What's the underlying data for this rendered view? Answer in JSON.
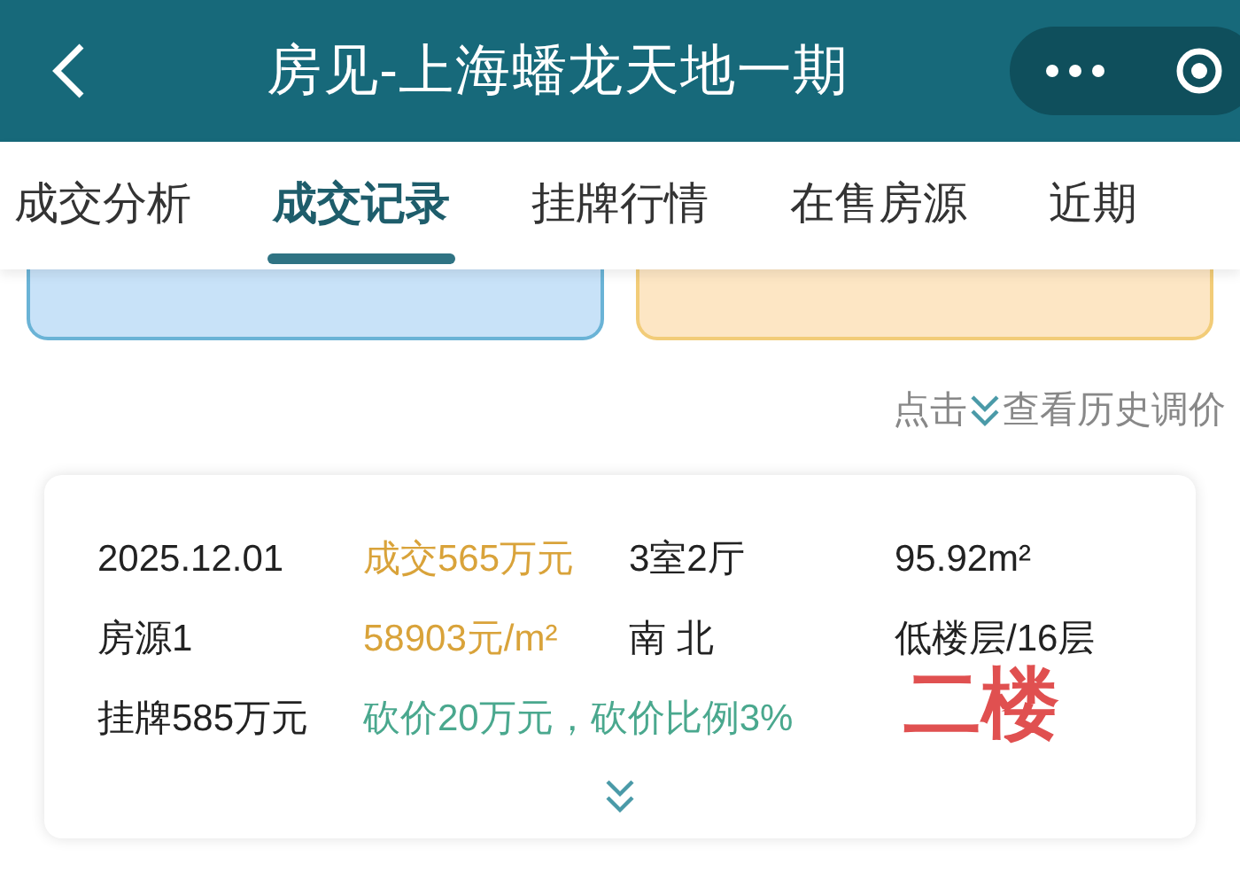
{
  "header": {
    "title": "房见-上海蟠龙天地一期"
  },
  "tabs": [
    {
      "label": "成交分析",
      "selected": false
    },
    {
      "label": "成交记录",
      "selected": true
    },
    {
      "label": "挂牌行情",
      "selected": false
    },
    {
      "label": "在售房源",
      "selected": false
    },
    {
      "label": "近期",
      "selected": false
    }
  ],
  "history_link": {
    "before": "点击",
    "after": "查看历史调价"
  },
  "record": {
    "rows": [
      [
        {
          "text": "2025.12.01",
          "kind": "plain"
        },
        {
          "text": "成交565万元",
          "kind": "price"
        },
        {
          "text": "3室2厅",
          "kind": "plain"
        },
        {
          "text": "95.92m²",
          "kind": "plain"
        }
      ],
      [
        {
          "text": "房源1",
          "kind": "plain"
        },
        {
          "text": "58903元/m²",
          "kind": "price"
        },
        {
          "text": "南 北",
          "kind": "plain"
        },
        {
          "text": "低楼层/16层",
          "kind": "plain"
        }
      ],
      [
        {
          "text": "挂牌585万元",
          "kind": "plain"
        },
        {
          "text": "砍价20万元，砍价比例3%",
          "kind": "discount"
        }
      ]
    ]
  },
  "annotation": "二楼"
}
